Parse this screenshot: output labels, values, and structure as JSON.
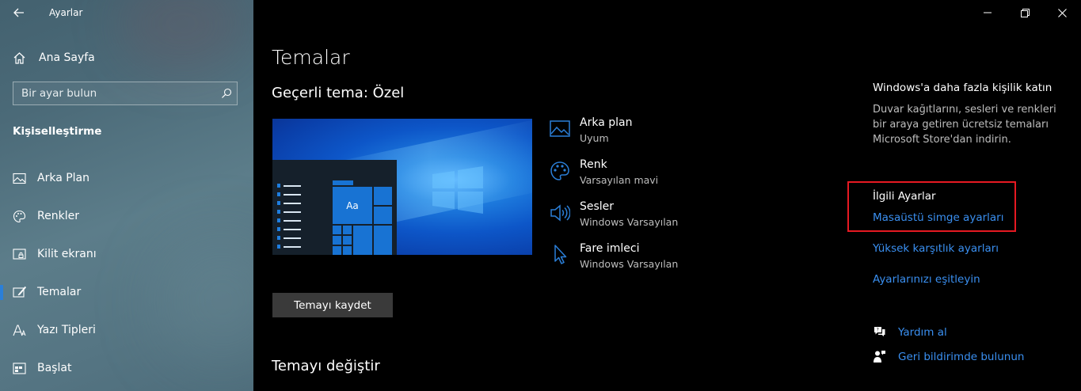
{
  "window": {
    "title": "Ayarlar",
    "controls": [
      "minimize",
      "restore",
      "close"
    ]
  },
  "sidebar": {
    "home_label": "Ana Sayfa",
    "search_placeholder": "Bir ayar bulun",
    "section_title": "Kişiselleştirme",
    "selected_item": "Temalar",
    "items": [
      {
        "label": "Arka Plan",
        "icon": "picture-icon"
      },
      {
        "label": "Renkler",
        "icon": "palette-icon"
      },
      {
        "label": "Kilit ekranı",
        "icon": "lock-screen-icon"
      },
      {
        "label": "Temalar",
        "icon": "themes-brush-icon"
      },
      {
        "label": "Yazı Tipleri",
        "icon": "font-icon"
      },
      {
        "label": "Başlat",
        "icon": "start-icon"
      }
    ]
  },
  "main": {
    "title": "Temalar",
    "current_theme_label": "Geçerli tema: Özel",
    "preview_tile_text": "Aa",
    "save_button_label": "Temayı kaydet",
    "change_theme_label": "Temayı değiştir",
    "theme_props": [
      {
        "title": "Arka plan",
        "value": "Uyum",
        "icon": "picture-icon"
      },
      {
        "title": "Renk",
        "value": "Varsayılan mavi",
        "icon": "palette-icon"
      },
      {
        "title": "Sesler",
        "value": "Windows Varsayılan",
        "icon": "speaker-icon"
      },
      {
        "title": "Fare imleci",
        "value": "Windows Varsayılan",
        "icon": "cursor-icon"
      }
    ]
  },
  "right_column": {
    "promo_title": "Windows'a daha fazla kişilik katın",
    "promo_desc": "Duvar kağıtlarını, sesleri ve renkleri bir araya getiren ücretsiz temaları Microsoft Store'dan indirin.",
    "related_title": "İlgili Ayarlar",
    "links": [
      "Masaüstü simge ayarları",
      "Yüksek karşıtlık ayarları",
      "Ayarlarınızı eşitleyin"
    ],
    "help_label": "Yardım al",
    "feedback_label": "Geri bildirimde bulunun"
  },
  "colors": {
    "accent": "#2b7fd8",
    "link": "#3a8ff0",
    "highlight_box": "#e61922",
    "background": "#000000"
  }
}
